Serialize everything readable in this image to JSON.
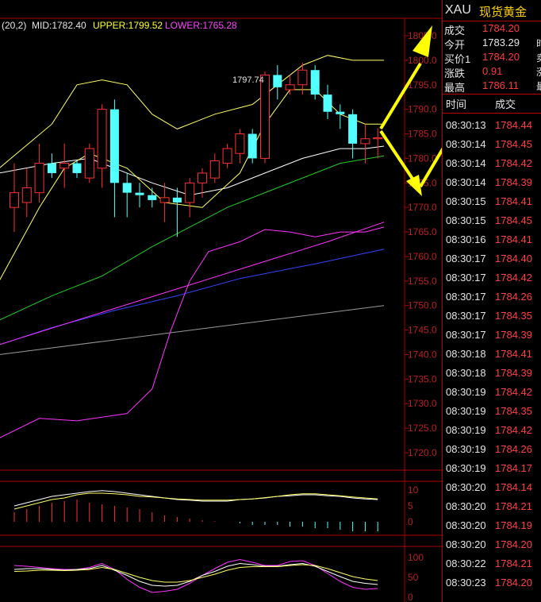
{
  "chart_header": {
    "params": "(20,2)",
    "mid": "MID:1782.40",
    "upper": "UPPER:1799.52",
    "lower": "LOWER:1765.28"
  },
  "price_axis": {
    "ticks": [
      "1805.0",
      "1800.0",
      "1795.0",
      "1790.0",
      "1785.0",
      "1780.0",
      "1775.0",
      "1770.0",
      "1765.0",
      "1760.0",
      "1755.0",
      "1750.0",
      "1745.0",
      "1740.0",
      "1735.0",
      "1730.0",
      "1725.0",
      "1720.0"
    ]
  },
  "high_marker": "1797.74",
  "macd_axis": {
    "ticks": [
      "10",
      "5",
      "0"
    ]
  },
  "kdj_axis": {
    "ticks": [
      "100",
      "50",
      "0"
    ]
  },
  "colors": {
    "up": "#ff3030",
    "down": "#54ffff",
    "border": "#b00000",
    "ma_yellow": "#ffff66",
    "ma_white": "#ffffff",
    "ma_green": "#22cc22",
    "ma_magenta": "#ff33ff",
    "ma_blue": "#3344ff",
    "ma_gray": "#999999",
    "accent": "#ffd200"
  },
  "quote": {
    "symbol": "XAU",
    "name": "现货黄金",
    "rows": [
      {
        "label": "成交",
        "value": "1784.20",
        "trail": ""
      },
      {
        "label": "今开",
        "value": "1783.29",
        "trail": "时"
      },
      {
        "label": "买价1",
        "value": "1784.20",
        "trail": "卖"
      },
      {
        "label": "涨跌",
        "value": "0.91",
        "trail": "涨"
      },
      {
        "label": "最高",
        "value": "1786.11",
        "trail": "最"
      }
    ]
  },
  "ticks_table": {
    "headers": [
      "时间",
      "成交"
    ],
    "rows": [
      {
        "time": "08:30:13",
        "price": "1784.44"
      },
      {
        "time": "08:30:14",
        "price": "1784.45"
      },
      {
        "time": "08:30:14",
        "price": "1784.42"
      },
      {
        "time": "08:30:14",
        "price": "1784.39"
      },
      {
        "time": "08:30:15",
        "price": "1784.41"
      },
      {
        "time": "08:30:15",
        "price": "1784.45"
      },
      {
        "time": "08:30:16",
        "price": "1784.41"
      },
      {
        "time": "08:30:17",
        "price": "1784.40"
      },
      {
        "time": "08:30:17",
        "price": "1784.42"
      },
      {
        "time": "08:30:17",
        "price": "1784.26"
      },
      {
        "time": "08:30:17",
        "price": "1784.35"
      },
      {
        "time": "08:30:17",
        "price": "1784.39"
      },
      {
        "time": "08:30:18",
        "price": "1784.41"
      },
      {
        "time": "08:30:18",
        "price": "1784.39"
      },
      {
        "time": "08:30:19",
        "price": "1784.42"
      },
      {
        "time": "08:30:19",
        "price": "1784.35"
      },
      {
        "time": "08:30:19",
        "price": "1784.42"
      },
      {
        "time": "08:30:19",
        "price": "1784.26"
      },
      {
        "time": "08:30:19",
        "price": "1784.17"
      },
      {
        "time": "08:30:20",
        "price": "1784.14"
      },
      {
        "time": "08:30:20",
        "price": "1784.21"
      },
      {
        "time": "08:30:20",
        "price": "1784.19"
      },
      {
        "time": "08:30:20",
        "price": "1784.20"
      },
      {
        "time": "08:30:22",
        "price": "1784.21"
      },
      {
        "time": "08:30:23",
        "price": "1784.20"
      }
    ]
  },
  "chart_data": {
    "type": "candlestick",
    "y_range": [
      1717,
      1807
    ],
    "candles": [
      {
        "o": 1770.0,
        "h": 1779.0,
        "l": 1765.0,
        "c": 1773.0
      },
      {
        "o": 1771.0,
        "h": 1778.0,
        "l": 1768.0,
        "c": 1774.0
      },
      {
        "o": 1773.0,
        "h": 1783.0,
        "l": 1771.0,
        "c": 1779.0
      },
      {
        "o": 1779.0,
        "h": 1781.0,
        "l": 1776.0,
        "c": 1777.0
      },
      {
        "o": 1778.0,
        "h": 1783.0,
        "l": 1774.0,
        "c": 1779.0
      },
      {
        "o": 1779.0,
        "h": 1779.5,
        "l": 1776.0,
        "c": 1777.0
      },
      {
        "o": 1776.0,
        "h": 1783.0,
        "l": 1775.0,
        "c": 1782.0
      },
      {
        "o": 1778.0,
        "h": 1791.0,
        "l": 1774.0,
        "c": 1790.0
      },
      {
        "o": 1790.0,
        "h": 1792.0,
        "l": 1768.0,
        "c": 1775.0
      },
      {
        "o": 1775.0,
        "h": 1777.0,
        "l": 1768.0,
        "c": 1773.0
      },
      {
        "o": 1773.0,
        "h": 1775.0,
        "l": 1770.0,
        "c": 1772.5
      },
      {
        "o": 1772.5,
        "h": 1774.0,
        "l": 1770.0,
        "c": 1771.5
      },
      {
        "o": 1771.0,
        "h": 1775.0,
        "l": 1767.0,
        "c": 1772.0
      },
      {
        "o": 1772.0,
        "h": 1774.0,
        "l": 1764.0,
        "c": 1771.0
      },
      {
        "o": 1771.0,
        "h": 1776.0,
        "l": 1768.0,
        "c": 1775.0
      },
      {
        "o": 1775.0,
        "h": 1778.0,
        "l": 1772.0,
        "c": 1777.0
      },
      {
        "o": 1776.0,
        "h": 1781.0,
        "l": 1775.0,
        "c": 1779.5
      },
      {
        "o": 1779.0,
        "h": 1783.0,
        "l": 1778.0,
        "c": 1782.0
      },
      {
        "o": 1781.0,
        "h": 1786.0,
        "l": 1779.0,
        "c": 1785.0
      },
      {
        "o": 1785.0,
        "h": 1786.0,
        "l": 1779.0,
        "c": 1780.0
      },
      {
        "o": 1780.0,
        "h": 1797.74,
        "l": 1779.0,
        "c": 1797.0
      },
      {
        "o": 1797.0,
        "h": 1799.0,
        "l": 1792.0,
        "c": 1794.5
      },
      {
        "o": 1794.0,
        "h": 1797.0,
        "l": 1793.0,
        "c": 1795.0
      },
      {
        "o": 1795.0,
        "h": 1799.5,
        "l": 1793.0,
        "c": 1798.0
      },
      {
        "o": 1798.0,
        "h": 1799.0,
        "l": 1792.0,
        "c": 1793.0
      },
      {
        "o": 1793.0,
        "h": 1795.0,
        "l": 1788.0,
        "c": 1789.5
      },
      {
        "o": 1789.5,
        "h": 1791.0,
        "l": 1786.0,
        "c": 1789.0
      },
      {
        "o": 1789.0,
        "h": 1790.0,
        "l": 1780.0,
        "c": 1783.0
      },
      {
        "o": 1783.0,
        "h": 1787.0,
        "l": 1779.0,
        "c": 1784.0
      },
      {
        "o": 1784.0,
        "h": 1786.11,
        "l": 1780.0,
        "c": 1784.2
      }
    ],
    "last_price_label": "1784.20"
  }
}
